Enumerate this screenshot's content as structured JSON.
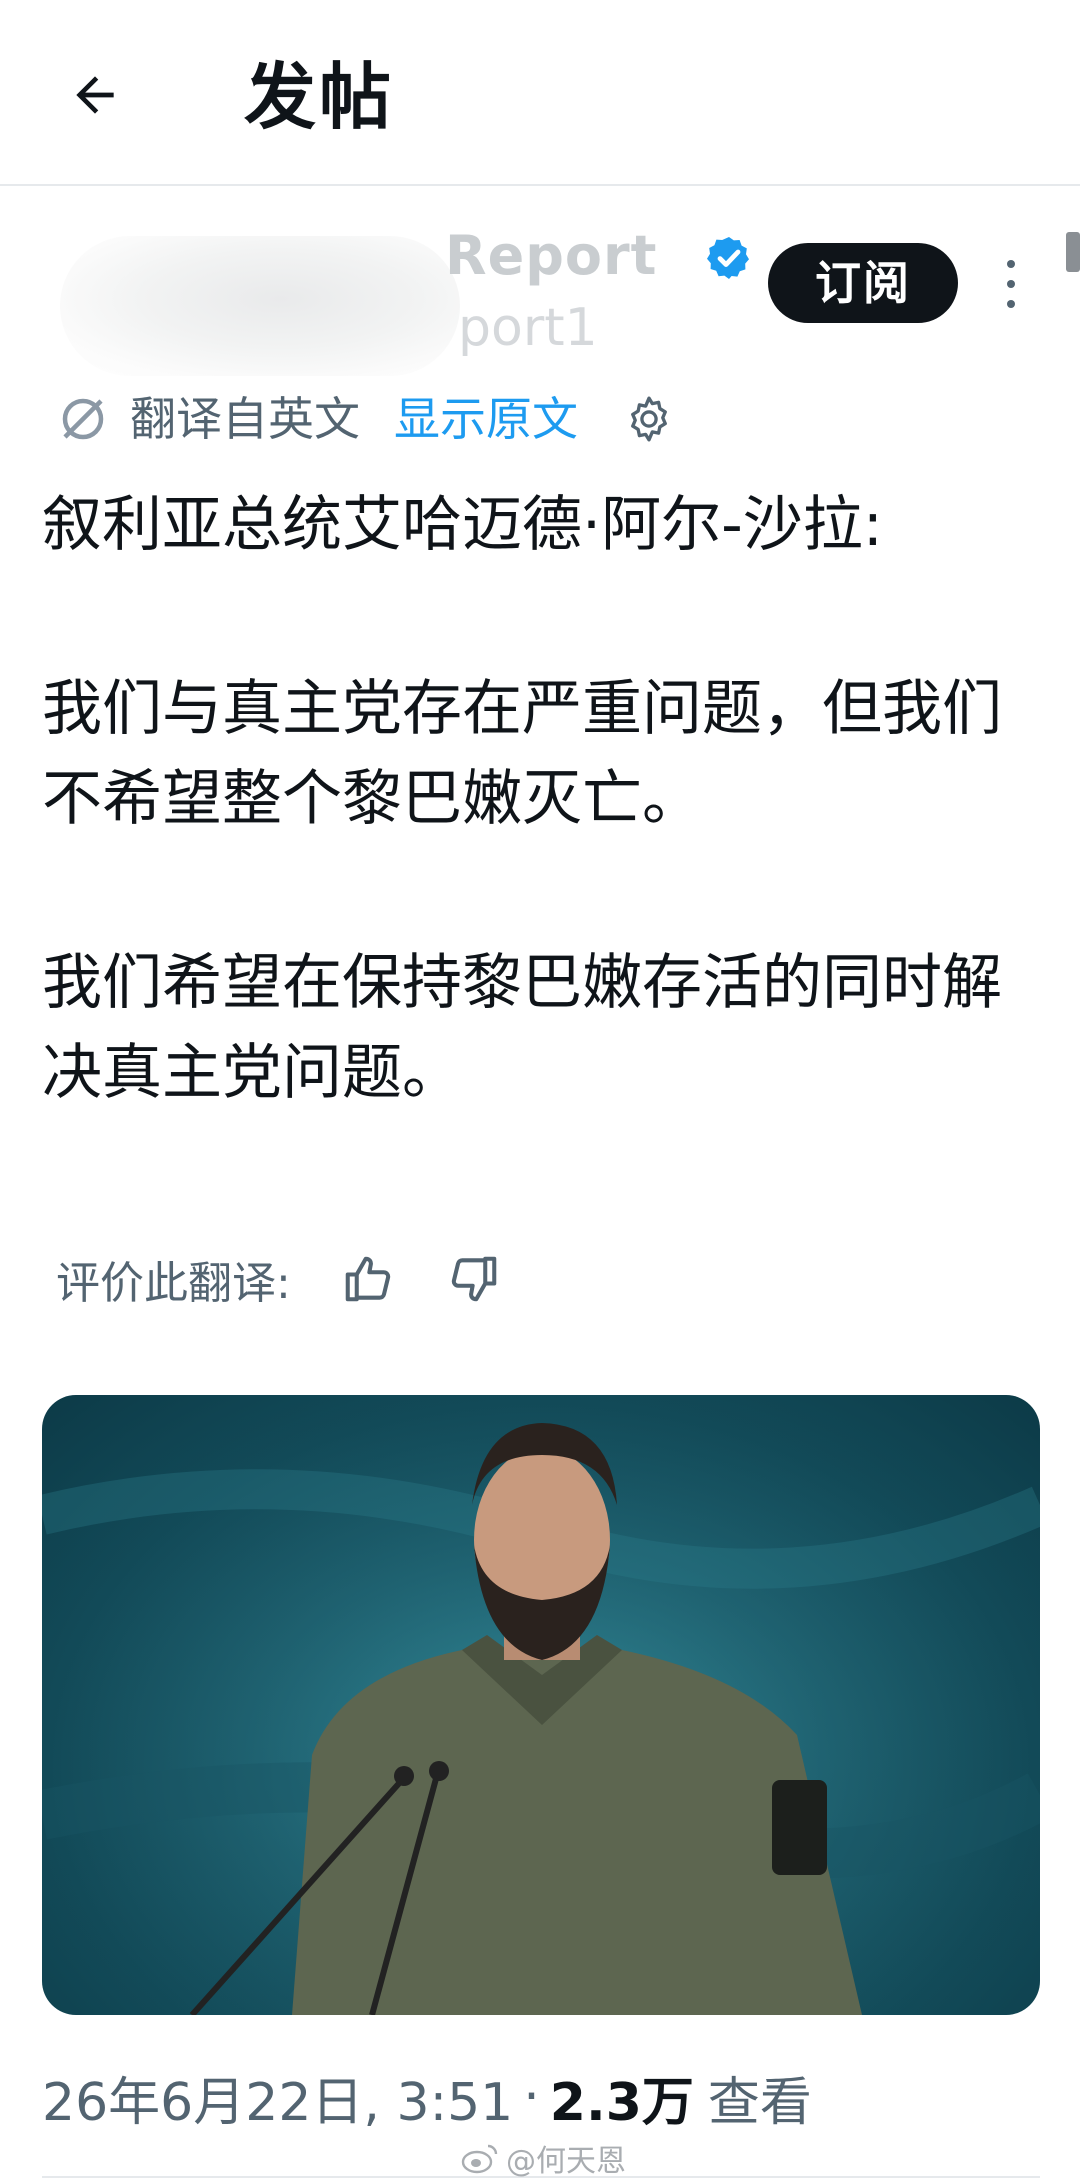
{
  "header": {
    "back_icon": "arrow-left-icon",
    "title": "发帖"
  },
  "author": {
    "name": "Report",
    "handle": "port1",
    "verified_color": "#1d9bf0"
  },
  "subscribe_label": "订阅",
  "translation": {
    "label": "翻译自英文",
    "show_original": "显示原文",
    "settings_icon": "gear-icon"
  },
  "post": {
    "paragraphs": [
      "叙利亚总统艾哈迈德·阿尔-沙拉:",
      "我们与真主党存在严重问题，但我们不希望整个黎巴嫩灭亡。",
      "我们希望在保持黎巴嫩存活的同时解决真主党问题。"
    ]
  },
  "rate": {
    "label": "评价此翻译:",
    "up_icon": "thumbs-up-icon",
    "down_icon": "thumbs-down-icon"
  },
  "meta": {
    "date": "26年6月22日, 3:51",
    "separator": "·",
    "views_count": "2.3万",
    "views_label": "查看"
  },
  "watermark": "@何天恩",
  "colors": {
    "accent": "#1d9bf0",
    "text": "#0f1419",
    "secondary": "#536471"
  }
}
